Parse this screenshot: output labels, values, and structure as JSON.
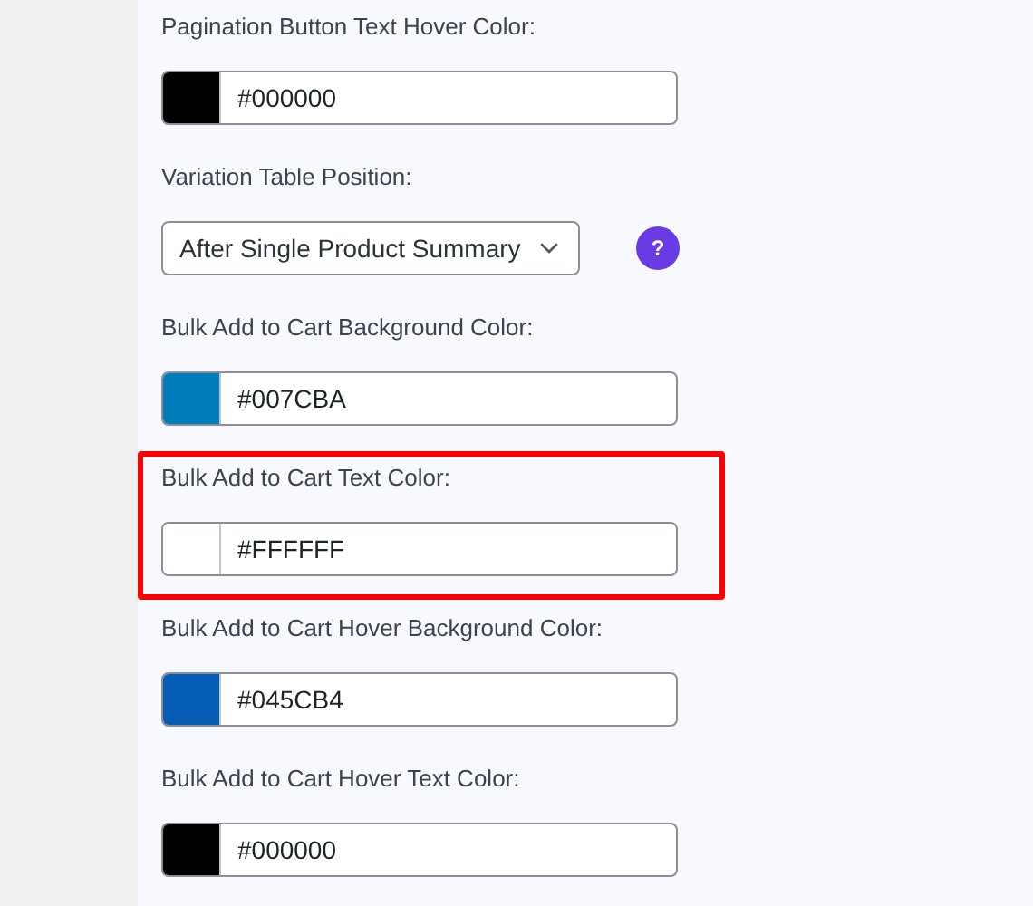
{
  "settings": [
    {
      "kind": "color",
      "label": "Pagination Button Text Hover Color:",
      "value": "#000000",
      "color": "#000000",
      "highlighted": false
    },
    {
      "kind": "select",
      "label": "Variation Table Position:",
      "value": "After Single Product Summary",
      "help": "?",
      "highlighted": false
    },
    {
      "kind": "color",
      "label": "Bulk Add to Cart Background Color:",
      "value": "#007CBA",
      "color": "#007cba",
      "highlighted": false
    },
    {
      "kind": "color",
      "label": "Bulk Add to Cart Text Color:",
      "value": "#FFFFFF",
      "color": "#ffffff",
      "highlighted": true
    },
    {
      "kind": "color",
      "label": "Bulk Add to Cart Hover Background Color:",
      "value": "#045CB4",
      "color": "#045cb4",
      "highlighted": false
    },
    {
      "kind": "color",
      "label": "Bulk Add to Cart Hover Text Color:",
      "value": "#000000",
      "color": "#000000",
      "highlighted": false
    }
  ]
}
